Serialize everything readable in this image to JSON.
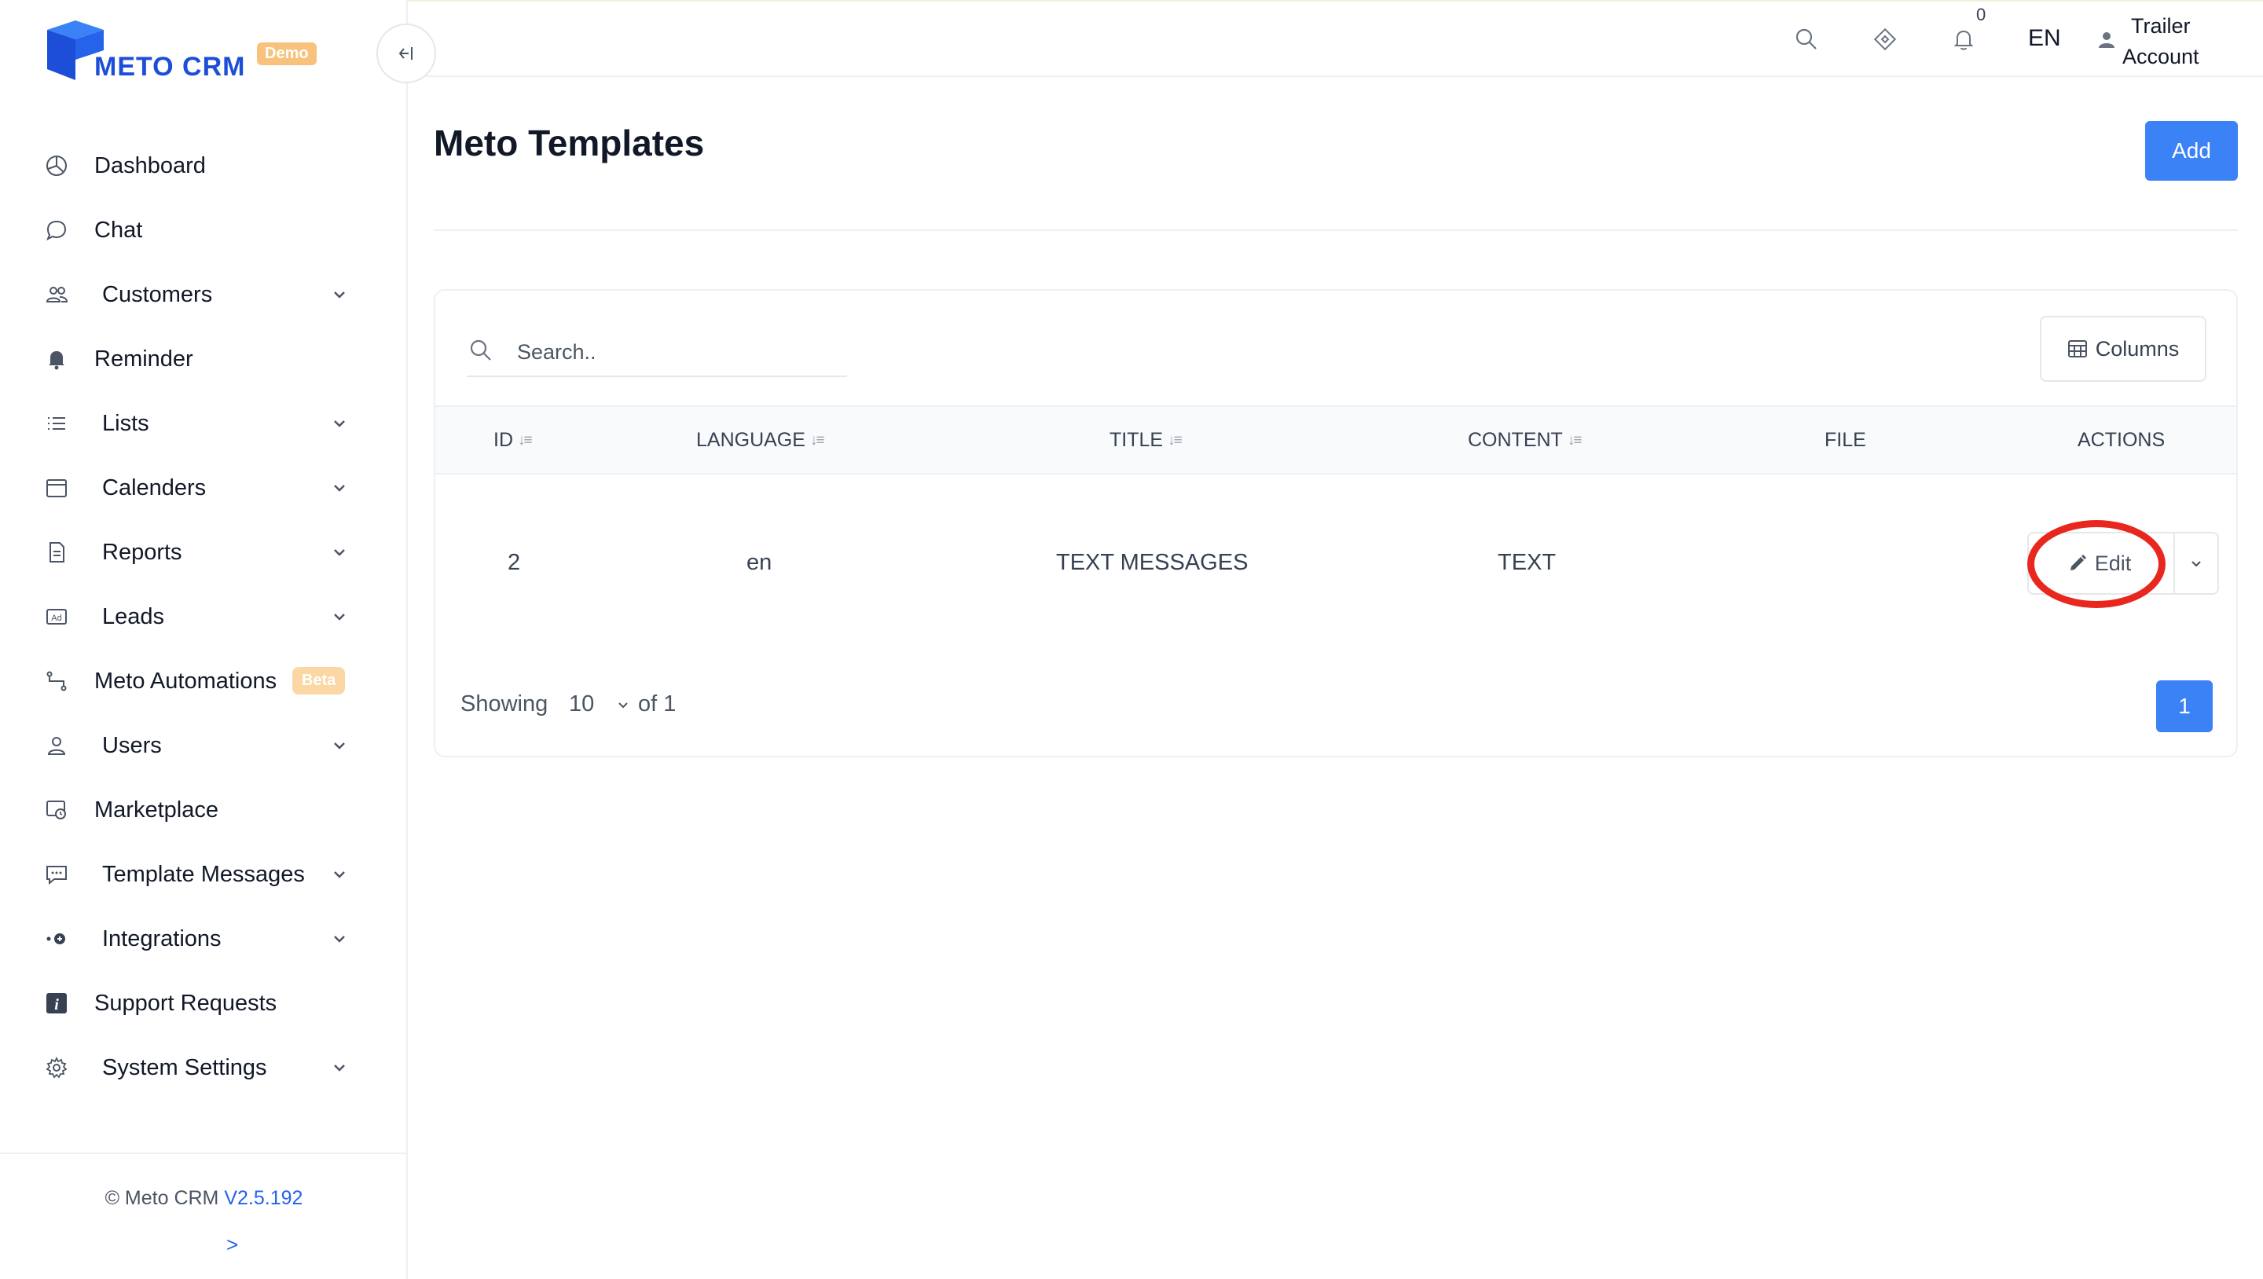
{
  "brand": {
    "name": "METO CRM",
    "badge": "Demo"
  },
  "sidebar": {
    "items": [
      {
        "label": "Dashboard",
        "icon": "pie-chart-icon",
        "expandable": false
      },
      {
        "label": "Chat",
        "icon": "chat-bubble-icon",
        "expandable": false
      },
      {
        "label": "Customers",
        "icon": "users-icon",
        "expandable": true
      },
      {
        "label": "Reminder",
        "icon": "bell-filled-icon",
        "expandable": false
      },
      {
        "label": "Lists",
        "icon": "list-icon",
        "expandable": true
      },
      {
        "label": "Calenders",
        "icon": "calendar-icon",
        "expandable": true
      },
      {
        "label": "Reports",
        "icon": "report-file-icon",
        "expandable": true
      },
      {
        "label": "Leads",
        "icon": "ad-icon",
        "expandable": true
      },
      {
        "label": "Meto Automations",
        "icon": "automation-icon",
        "expandable": false,
        "badge": "Beta"
      },
      {
        "label": "Users",
        "icon": "user-icon",
        "expandable": true
      },
      {
        "label": "Marketplace",
        "icon": "marketplace-icon",
        "expandable": false
      },
      {
        "label": "Template Messages",
        "icon": "message-template-icon",
        "expandable": true
      },
      {
        "label": "Integrations",
        "icon": "integration-icon",
        "expandable": true
      },
      {
        "label": "Support Requests",
        "icon": "info-square-icon",
        "expandable": false
      },
      {
        "label": "System Settings",
        "icon": "gear-icon",
        "expandable": true
      }
    ],
    "footer": {
      "copyright": "© Meto CRM",
      "version": "V2.5.192",
      "expand_arrow": ">"
    }
  },
  "topbar": {
    "notification_count": "0",
    "language": "EN",
    "account_line1": "Trailer",
    "account_line2": "Account"
  },
  "page": {
    "title": "Meto Templates",
    "add_label": "Add"
  },
  "table": {
    "search_placeholder": "Search..",
    "columns_label": "Columns",
    "headers": [
      "ID",
      "LANGUAGE",
      "TITLE",
      "CONTENT",
      "FILE",
      "ACTIONS"
    ],
    "rows": [
      {
        "id": "2",
        "language": "en",
        "title": "TEXT MESSAGES",
        "content": "TEXT",
        "file": ""
      }
    ],
    "edit_label": "Edit",
    "pagination": {
      "showing_label": "Showing",
      "per_page": "10",
      "of_label": "of 1",
      "current_page": "1"
    }
  },
  "colors": {
    "accent": "#3b82f6",
    "brand": "#1d4ed8",
    "highlight": "#e8271f",
    "badge": "#f8c27c"
  }
}
